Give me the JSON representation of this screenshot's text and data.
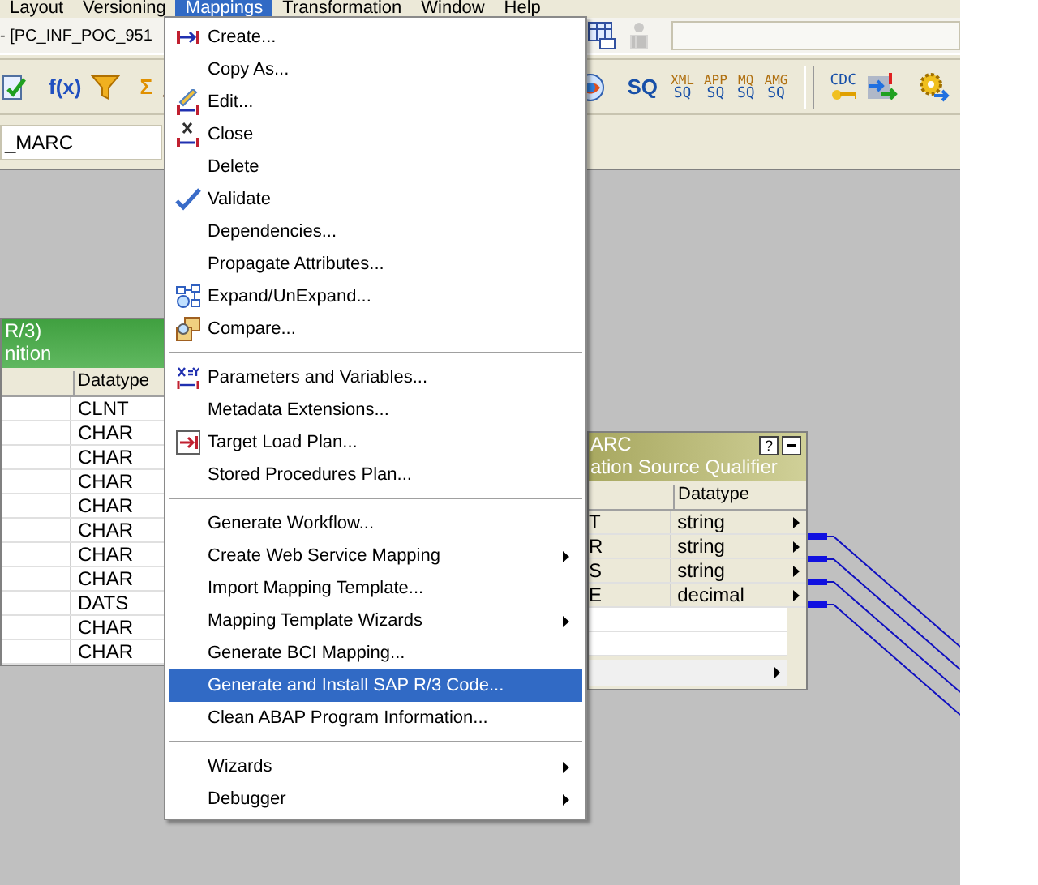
{
  "menubar": [
    {
      "label": "Layout",
      "selected": false
    },
    {
      "label": "Versioning",
      "selected": false
    },
    {
      "label": "Mappings",
      "selected": true
    },
    {
      "label": "Transformation",
      "selected": false
    },
    {
      "label": "Window",
      "selected": false
    },
    {
      "label": "Help",
      "selected": false
    }
  ],
  "title_bar": {
    "title": "- [PC_INF_POC_951"
  },
  "title_tools": [
    {
      "disabled": false
    },
    {
      "disabled": true
    }
  ],
  "toolbar_left": [
    {
      "kind": "icon"
    },
    {
      "kind": "text",
      "label": "f(x)",
      "color": "#2050c0"
    },
    {
      "kind": "icon"
    },
    {
      "kind": "text",
      "label": "Σ",
      "color": "#e09000"
    },
    {
      "kind": "icon"
    }
  ],
  "toolbar_right": [
    {
      "kind": "icon"
    },
    {
      "kind": "text",
      "label": "SQ",
      "color": "#1850a8"
    },
    {
      "kind": "stack",
      "top": "XML",
      "bottom": "SQ"
    },
    {
      "kind": "stack",
      "top": "APP",
      "bottom": "SQ"
    },
    {
      "kind": "stack",
      "top": "MQ",
      "bottom": "SQ"
    },
    {
      "kind": "stack",
      "top": "AMG",
      "bottom": "SQ"
    },
    {
      "kind": "separator"
    },
    {
      "kind": "key",
      "top": "CDC"
    },
    {
      "kind": "icon"
    },
    {
      "kind": "icon"
    }
  ],
  "mapping_field": {
    "value": "_MARC"
  },
  "left_node": {
    "title": "R/3)",
    "subtitle": "nition",
    "columns": [
      "Datatype"
    ],
    "rows": [
      "CLNT",
      "CHAR",
      "CHAR",
      "CHAR",
      "CHAR",
      "CHAR",
      "CHAR",
      "CHAR",
      "DATS",
      "CHAR",
      "CHAR"
    ]
  },
  "right_node": {
    "title": "ARC",
    "subtitle": "ation Source Qualifier",
    "help": "?",
    "columns": [
      "Datatype"
    ],
    "rows": [
      {
        "name": "T",
        "type": "string"
      },
      {
        "name": "R",
        "type": "string"
      },
      {
        "name": "S",
        "type": "string"
      },
      {
        "name": "E",
        "type": "decimal"
      }
    ]
  },
  "menu": {
    "items": [
      {
        "kind": "item",
        "label": "Create...",
        "checked": false,
        "submenu": false,
        "selected": false
      },
      {
        "kind": "item",
        "label": "Copy As...",
        "checked": false,
        "submenu": false,
        "selected": false
      },
      {
        "kind": "item",
        "label": "Edit...",
        "checked": false,
        "submenu": false,
        "selected": false
      },
      {
        "kind": "item",
        "label": "Close",
        "checked": false,
        "submenu": false,
        "selected": false
      },
      {
        "kind": "item",
        "label": "Delete",
        "checked": false,
        "submenu": false,
        "selected": false
      },
      {
        "kind": "item",
        "label": "Validate",
        "checked": true,
        "submenu": false,
        "selected": false
      },
      {
        "kind": "item",
        "label": "Dependencies...",
        "checked": false,
        "submenu": false,
        "selected": false
      },
      {
        "kind": "item",
        "label": "Propagate Attributes...",
        "checked": false,
        "submenu": false,
        "selected": false
      },
      {
        "kind": "item",
        "label": "Expand/UnExpand...",
        "checked": false,
        "submenu": false,
        "selected": false
      },
      {
        "kind": "item",
        "label": "Compare...",
        "checked": false,
        "submenu": false,
        "selected": false
      },
      {
        "kind": "separator"
      },
      {
        "kind": "item",
        "label": "Parameters and Variables...",
        "checked": false,
        "submenu": false,
        "selected": false
      },
      {
        "kind": "item",
        "label": "Metadata Extensions...",
        "checked": false,
        "submenu": false,
        "selected": false
      },
      {
        "kind": "item",
        "label": "Target Load Plan...",
        "checked": false,
        "submenu": false,
        "selected": false
      },
      {
        "kind": "item",
        "label": "Stored Procedures Plan...",
        "checked": false,
        "submenu": false,
        "selected": false
      },
      {
        "kind": "separator"
      },
      {
        "kind": "item",
        "label": "Generate Workflow...",
        "checked": false,
        "submenu": false,
        "selected": false
      },
      {
        "kind": "item",
        "label": "Create Web Service Mapping",
        "checked": false,
        "submenu": true,
        "selected": false
      },
      {
        "kind": "item",
        "label": "Import Mapping Template...",
        "checked": false,
        "submenu": false,
        "selected": false
      },
      {
        "kind": "item",
        "label": "Mapping Template Wizards",
        "checked": false,
        "submenu": true,
        "selected": false
      },
      {
        "kind": "item",
        "label": "Generate BCI Mapping...",
        "checked": false,
        "submenu": false,
        "selected": false
      },
      {
        "kind": "item",
        "label": "Generate and Install SAP R/3 Code...",
        "checked": false,
        "submenu": false,
        "selected": true
      },
      {
        "kind": "item",
        "label": "Clean ABAP Program Information...",
        "checked": false,
        "submenu": false,
        "selected": false
      },
      {
        "kind": "separator"
      },
      {
        "kind": "item",
        "label": "Wizards",
        "checked": false,
        "submenu": true,
        "selected": false
      },
      {
        "kind": "item",
        "label": "Debugger",
        "checked": false,
        "submenu": true,
        "selected": false
      }
    ]
  }
}
